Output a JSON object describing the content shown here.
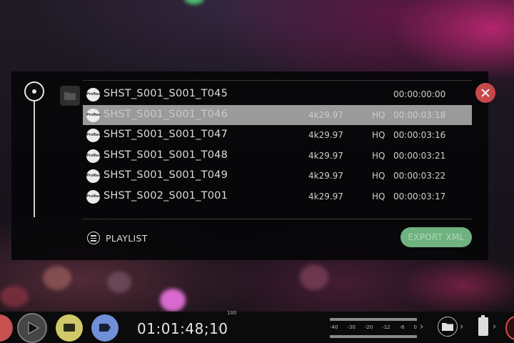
{
  "dialog": {
    "clips": [
      {
        "name": "SHST_S001_S001_T045",
        "format": "",
        "quality": "",
        "timecode": "00:00:00:00",
        "icon": "ProRes",
        "selected": false
      },
      {
        "name": "SHST_S001_S001_T046",
        "format": "4k29.97",
        "quality": "HQ",
        "timecode": "00:00:03:18",
        "icon": "ProRes",
        "selected": true
      },
      {
        "name": "SHST_S001_S001_T047",
        "format": "4k29.97",
        "quality": "HQ",
        "timecode": "00:00:03:16",
        "icon": "ProRes",
        "selected": false
      },
      {
        "name": "SHST_S001_S001_T048",
        "format": "4k29.97",
        "quality": "HQ",
        "timecode": "00:00:03:21",
        "icon": "ProRes",
        "selected": false
      },
      {
        "name": "SHST_S001_S001_T049",
        "format": "4k29.97",
        "quality": "HQ",
        "timecode": "00:00:03:22",
        "icon": "ProRes",
        "selected": false
      },
      {
        "name": "SHST_S002_S001_T001",
        "format": "4k29.97",
        "quality": "HQ",
        "timecode": "00:00:03:17",
        "icon": "ProRes",
        "selected": false
      }
    ],
    "playlist_label": "PLAYLIST",
    "export_label": "EXPORT XML",
    "colors": {
      "close": "#c84848",
      "export": "#6fb27f",
      "selected_row": "#9a9a9a"
    }
  },
  "controls": {
    "timecode": "01:01:48;10",
    "timecode_marker": "100",
    "meter_scale": [
      "-40",
      "-30",
      "-20",
      "-12",
      "-6",
      "0"
    ],
    "colors": {
      "record": "#c85050",
      "monitor": "#cfc96a",
      "tag": "#6f8fd6"
    }
  }
}
